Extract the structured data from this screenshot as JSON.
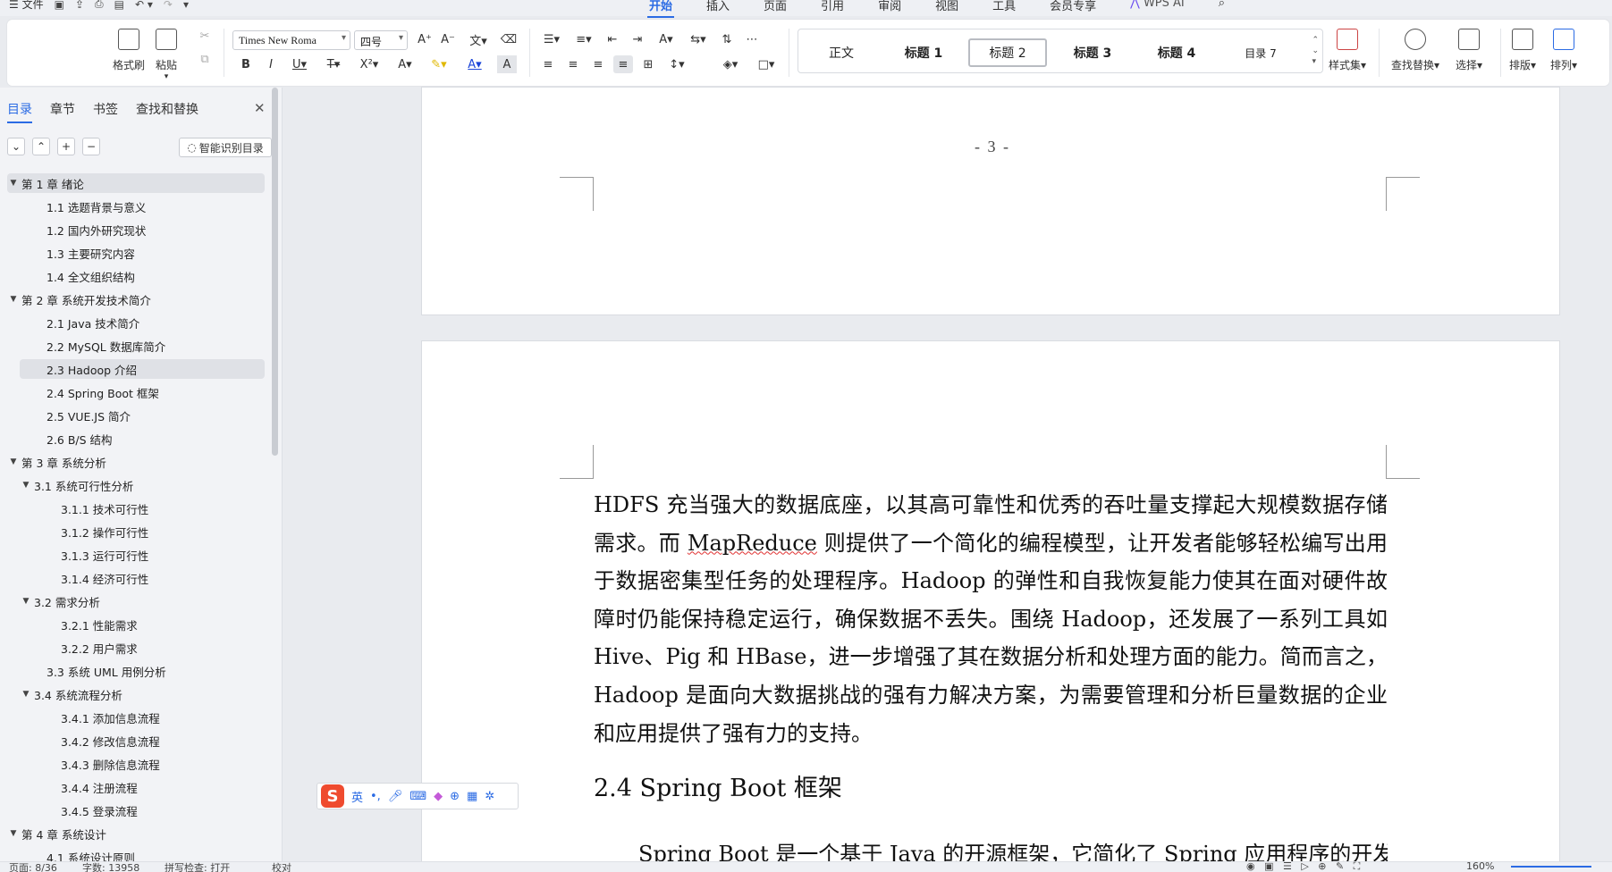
{
  "titlebar": {
    "file_menu": "文件",
    "tabs": [
      "开始",
      "插入",
      "页面",
      "引用",
      "审阅",
      "视图",
      "工具",
      "会员专享"
    ],
    "active_tab": "开始",
    "wps_ai": "WPS AI"
  },
  "ribbon": {
    "format_painter": "格式刷",
    "paste": "粘贴",
    "font_name": "Times New Roma",
    "font_size": "四号",
    "styles": [
      "正文",
      "标题 1",
      "标题 2",
      "标题 3",
      "标题 4",
      "目录 7"
    ],
    "selected_style": "标题 2",
    "style_set": "样式集",
    "find_replace": "查找替换",
    "select": "选择",
    "layout": "排版",
    "arrange": "排列"
  },
  "nav": {
    "tabs": [
      "目录",
      "章节",
      "书签",
      "查找和替换"
    ],
    "active_tab": "目录",
    "smart_toc": "智能识别目录",
    "toc": [
      {
        "label": "第 1 章  绪论",
        "level": 0,
        "expanded": true,
        "highlight": true
      },
      {
        "label": "1.1  选题背景与意义",
        "level": 1
      },
      {
        "label": "1.2  国内外研究现状",
        "level": 1
      },
      {
        "label": "1.3  主要研究内容",
        "level": 1
      },
      {
        "label": "1.4  全文组织结构",
        "level": 1
      },
      {
        "label": "第 2 章  系统开发技术简介",
        "level": 0,
        "expanded": true
      },
      {
        "label": "2.1  Java 技术简介",
        "level": 1
      },
      {
        "label": "2.2  MySQL 数据库简介",
        "level": 1
      },
      {
        "label": "2.3  Hadoop 介绍",
        "level": 1,
        "highlight": true
      },
      {
        "label": "2.4  Spring Boot 框架",
        "level": 1
      },
      {
        "label": "2.5  VUE.JS 简介",
        "level": 1
      },
      {
        "label": "2.6  B/S 结构",
        "level": 1
      },
      {
        "label": "第 3 章  系统分析",
        "level": 0,
        "expanded": true
      },
      {
        "label": "3.1  系统可行性分析",
        "level": 1,
        "expanded": true
      },
      {
        "label": "3.1.1  技术可行性",
        "level": 2
      },
      {
        "label": "3.1.2  操作可行性",
        "level": 2
      },
      {
        "label": "3.1.3  运行可行性",
        "level": 2
      },
      {
        "label": "3.1.4  经济可行性",
        "level": 2
      },
      {
        "label": "3.2  需求分析",
        "level": 1,
        "expanded": true
      },
      {
        "label": "3.2.1  性能需求",
        "level": 2
      },
      {
        "label": "3.2.2  用户需求",
        "level": 2
      },
      {
        "label": "3.3  系统 UML 用例分析",
        "level": 1
      },
      {
        "label": "3.4  系统流程分析",
        "level": 1,
        "expanded": true
      },
      {
        "label": "3.4.1  添加信息流程",
        "level": 2
      },
      {
        "label": "3.4.2  修改信息流程",
        "level": 2
      },
      {
        "label": "3.4.3  删除信息流程",
        "level": 2
      },
      {
        "label": "3.4.4  注册流程",
        "level": 2
      },
      {
        "label": "3.4.5  登录流程",
        "level": 2
      },
      {
        "label": "第 4 章  系统设计",
        "level": 0,
        "expanded": true
      },
      {
        "label": "4.1  系统设计原则",
        "level": 1
      }
    ]
  },
  "document": {
    "page_number": "- 3 -",
    "para1_a": "HDFS 充当强大的数据底座，以其高可靠性和优秀的吞吐量支撑起大规模数据存储需求。而 ",
    "para1_spell": "MapReduce",
    "para1_b": " 则提供了一个简化的编程模型，让开发者能够轻松编写出用于数据密集型任务的处理程序。Hadoop 的弹性和自我恢复能力使其在面对硬件故障时仍能保持稳定运行，确保数据不丢失。围绕 Hadoop，还发展了一系列工具如 Hive、Pig 和 HBase，进一步增强了其在数据分析和处理方面的能力。简而言之，Hadoop 是面向大数据挑战的强有力解决方案，为需要管理和分析巨量数据的企业和应用提供了强有力的支持。",
    "heading": "2.4  Spring Boot 框架",
    "para2": "Spring Boot 是一个基于 Java 的开源框架，它简化了 Spring 应用程序的开发"
  },
  "ime": {
    "logo": "S",
    "mode": "英"
  },
  "statusbar": {
    "page": "页面: 8/36",
    "words": "字数: 13958",
    "spell": "拼写检查: 打开",
    "proof": "校对",
    "zoom": "160%"
  }
}
